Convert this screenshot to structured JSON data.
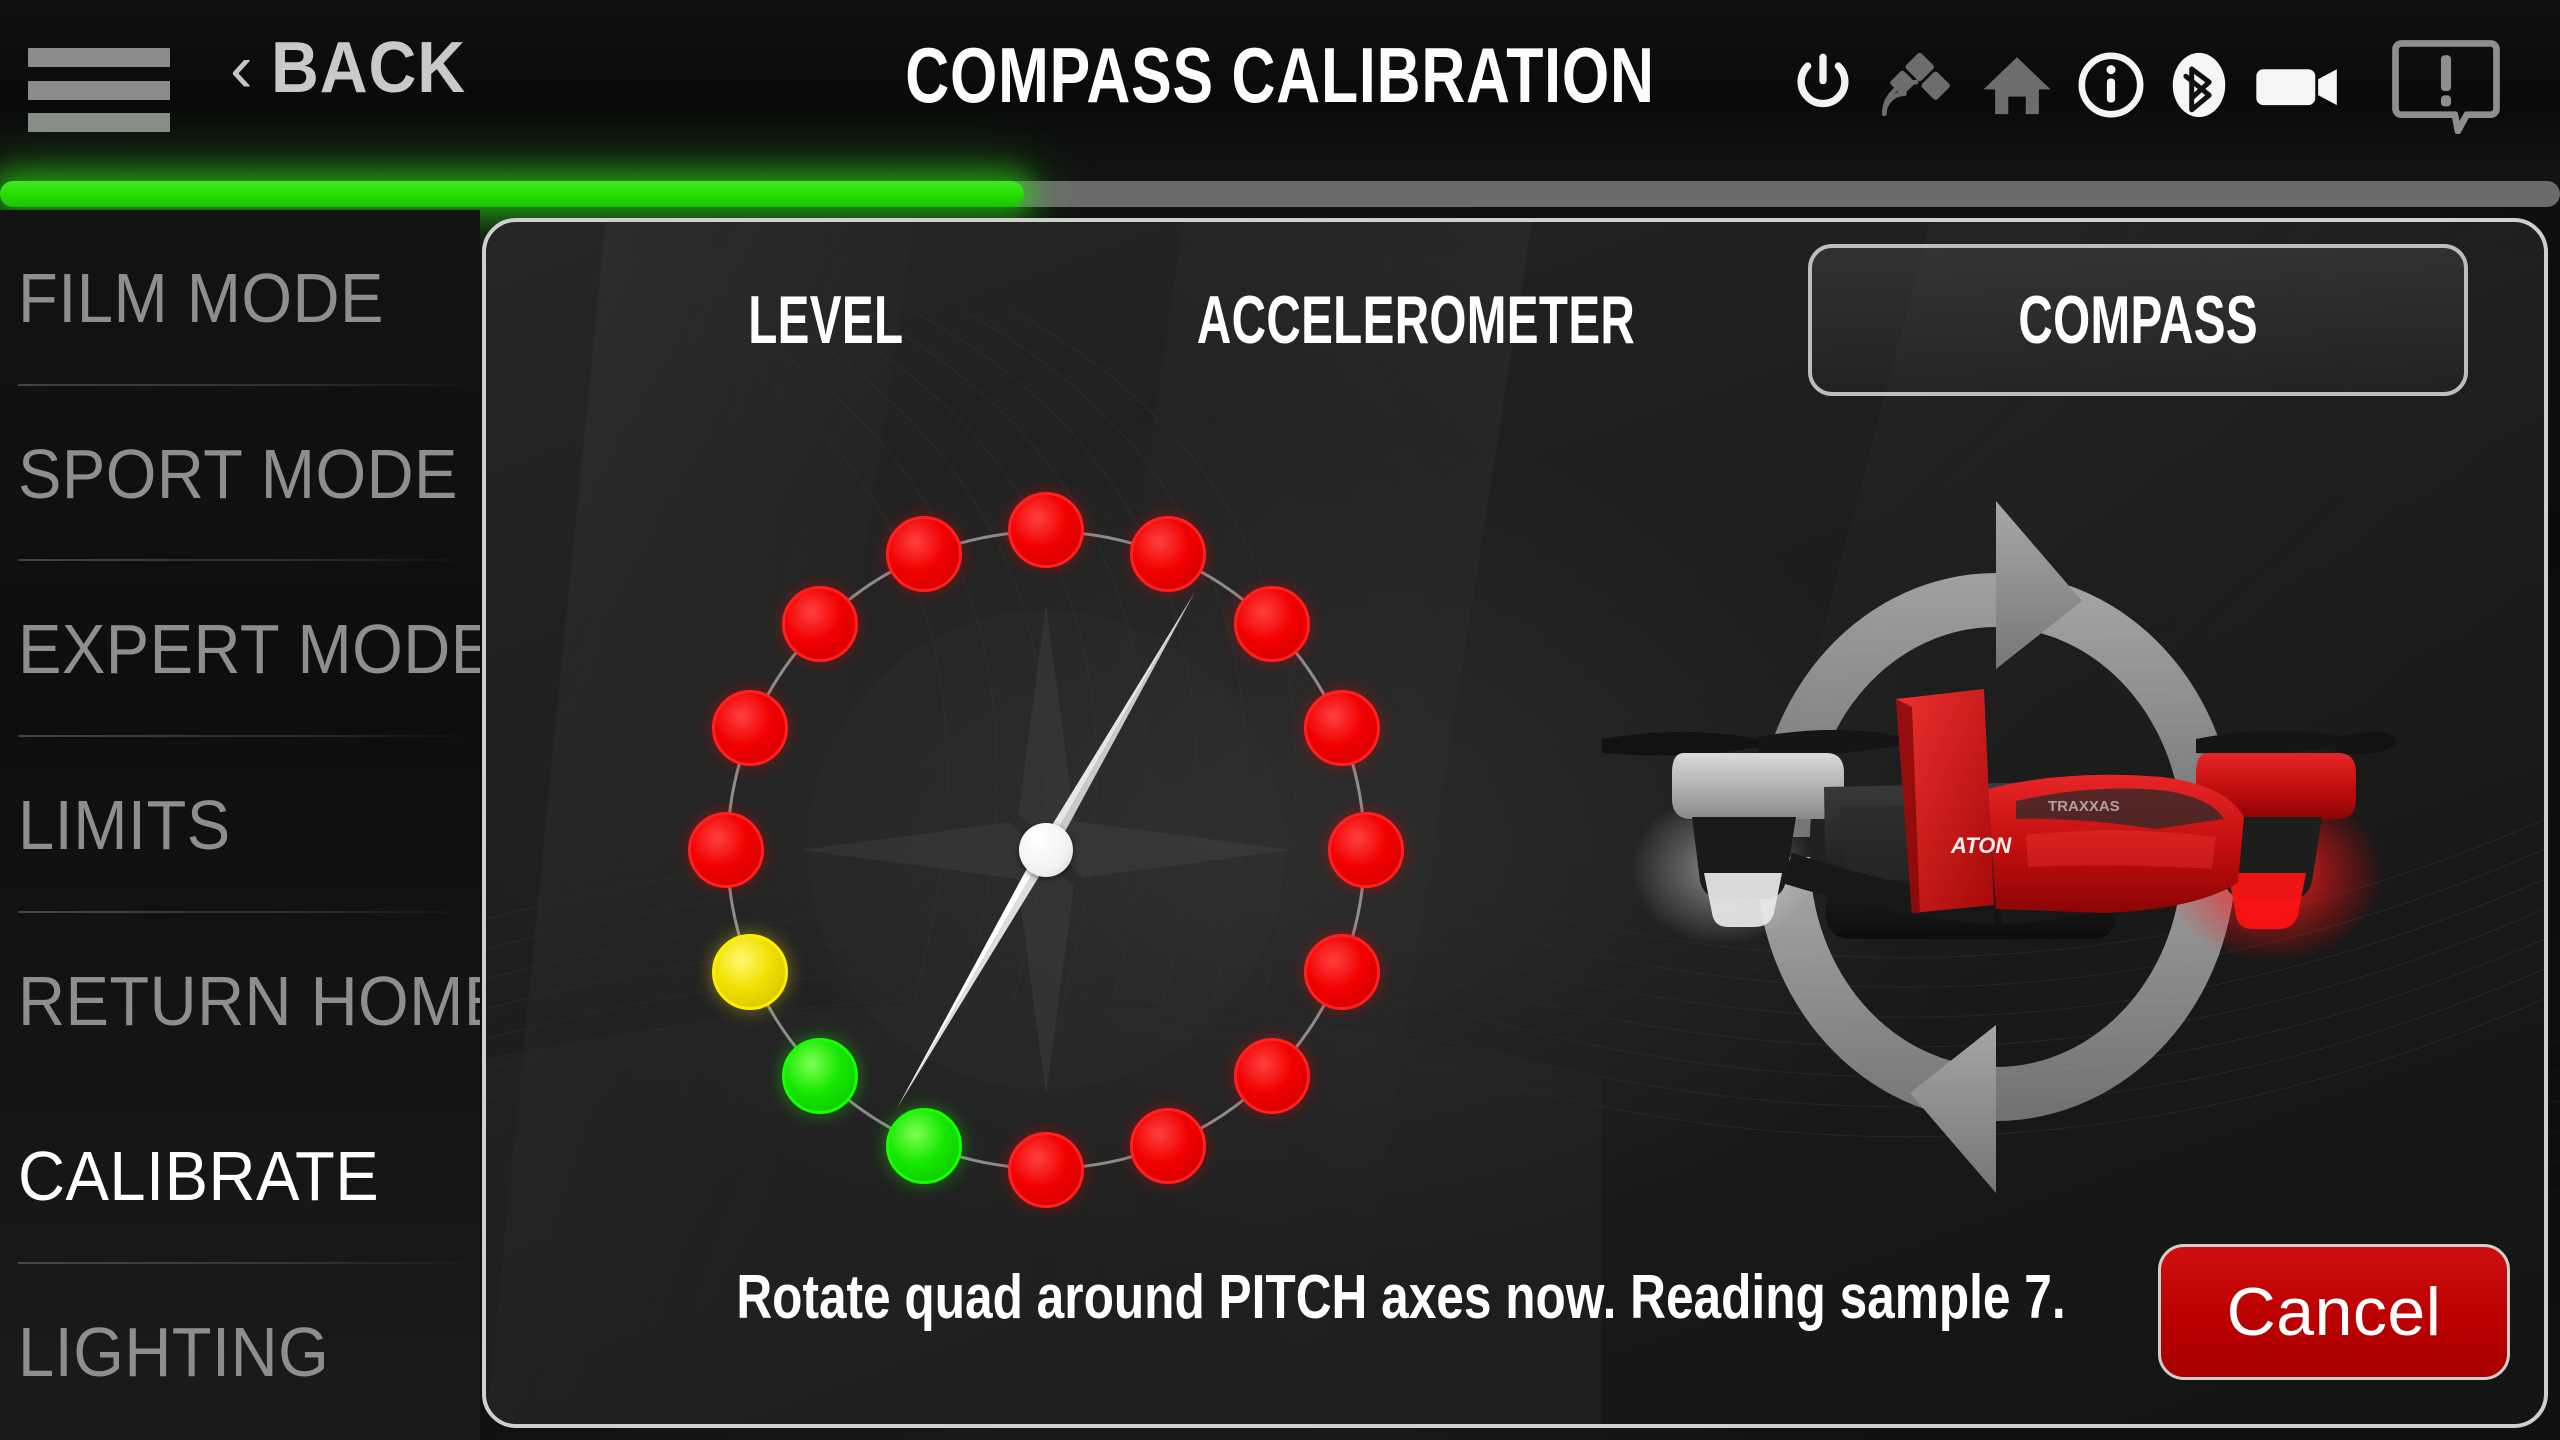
{
  "header": {
    "menu_icon": "hamburger-icon",
    "back_chevron": "‹",
    "back_label": "BACK",
    "title": "COMPASS CALIBRATION",
    "status_icons": [
      {
        "name": "power-icon",
        "state": "on"
      },
      {
        "name": "satellite-icon",
        "state": "dim"
      },
      {
        "name": "home-icon",
        "state": "dim"
      },
      {
        "name": "info-icon",
        "state": "on"
      },
      {
        "name": "bluetooth-icon",
        "state": "on"
      },
      {
        "name": "camera-icon",
        "state": "on"
      },
      {
        "name": "warning-bubble-icon",
        "state": "dim"
      }
    ]
  },
  "progress": {
    "percent": 40,
    "fill_color": "#25e000",
    "track_color": "#6b6b6b"
  },
  "sidebar": {
    "items": [
      {
        "label": "FILM MODE",
        "active": false
      },
      {
        "label": "SPORT MODE",
        "active": false
      },
      {
        "label": "EXPERT MODE",
        "active": false
      },
      {
        "label": "LIMITS",
        "active": false
      },
      {
        "label": "RETURN HOME",
        "active": false
      },
      {
        "label": "CALIBRATE",
        "active": true
      },
      {
        "label": "LIGHTING",
        "active": false
      }
    ]
  },
  "panel": {
    "tabs": [
      {
        "label": "LEVEL",
        "selected": false
      },
      {
        "label": "ACCELEROMETER",
        "selected": false
      },
      {
        "label": "COMPASS",
        "selected": true
      }
    ],
    "compass": {
      "needle_heading_deg": 30,
      "dot_count": 16,
      "dot_start_angle_deg": 0,
      "dot_step_deg": 22.5,
      "dot_states": [
        "red",
        "red",
        "red",
        "red",
        "red",
        "red",
        "red",
        "red",
        "red",
        "green",
        "green",
        "yellow",
        "red",
        "red",
        "red",
        "red"
      ],
      "colors": {
        "red": "#f20000",
        "green": "#14e800",
        "yellow": "#f0e000"
      }
    },
    "drone": {
      "graphic": "quadcopter-rotation-graphic",
      "body_color": "#cc1111",
      "arrow_color": "#c8c8c8"
    },
    "status_message": "Rotate quad around PITCH axes now. Reading sample 7.",
    "cancel_label": "Cancel",
    "cancel_color": "#bb0000"
  }
}
